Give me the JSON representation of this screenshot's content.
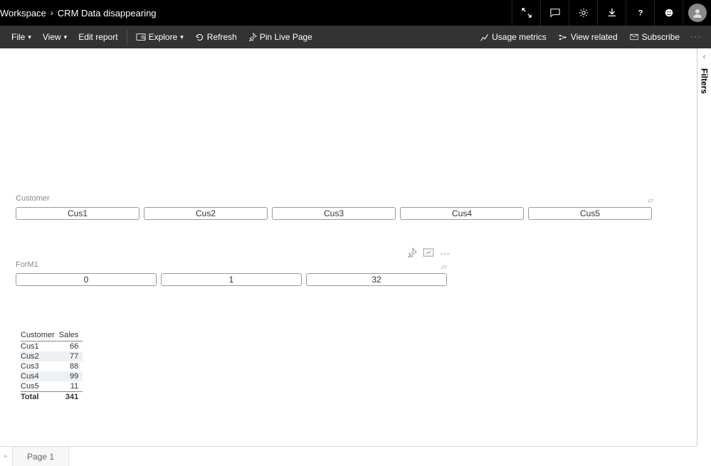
{
  "breadcrumb": {
    "workspace": "Workspace",
    "report": "CRM Data disappearing"
  },
  "toolbar": {
    "file": "File",
    "view": "View",
    "edit_report": "Edit report",
    "explore": "Explore",
    "refresh": "Refresh",
    "pin": "Pin Live Page",
    "usage_metrics": "Usage metrics",
    "view_related": "View related",
    "subscribe": "Subscribe"
  },
  "filtersPane": {
    "label": "Filters"
  },
  "slicer_customer": {
    "title": "Customer",
    "items": [
      "Cus1",
      "Cus2",
      "Cus3",
      "Cus4",
      "Cus5"
    ]
  },
  "slicer_form": {
    "title": "ForM1",
    "items": [
      "0",
      "1",
      "32"
    ]
  },
  "table_visual": {
    "columns": [
      "Customer",
      "Sales"
    ],
    "rows": [
      {
        "c": "Cus1",
        "v": 66
      },
      {
        "c": "Cus2",
        "v": 77
      },
      {
        "c": "Cus3",
        "v": 88
      },
      {
        "c": "Cus4",
        "v": 99
      },
      {
        "c": "Cus5",
        "v": 11
      }
    ],
    "total_label": "Total",
    "total_value": 341
  },
  "page_tabs": {
    "page1": "Page 1"
  },
  "chart_data": [
    {
      "type": "table",
      "title": "Customer Sales",
      "columns": [
        "Customer",
        "Sales"
      ],
      "rows": [
        [
          "Cus1",
          66
        ],
        [
          "Cus2",
          77
        ],
        [
          "Cus3",
          88
        ],
        [
          "Cus4",
          99
        ],
        [
          "Cus5",
          11
        ]
      ],
      "total": 341
    }
  ]
}
